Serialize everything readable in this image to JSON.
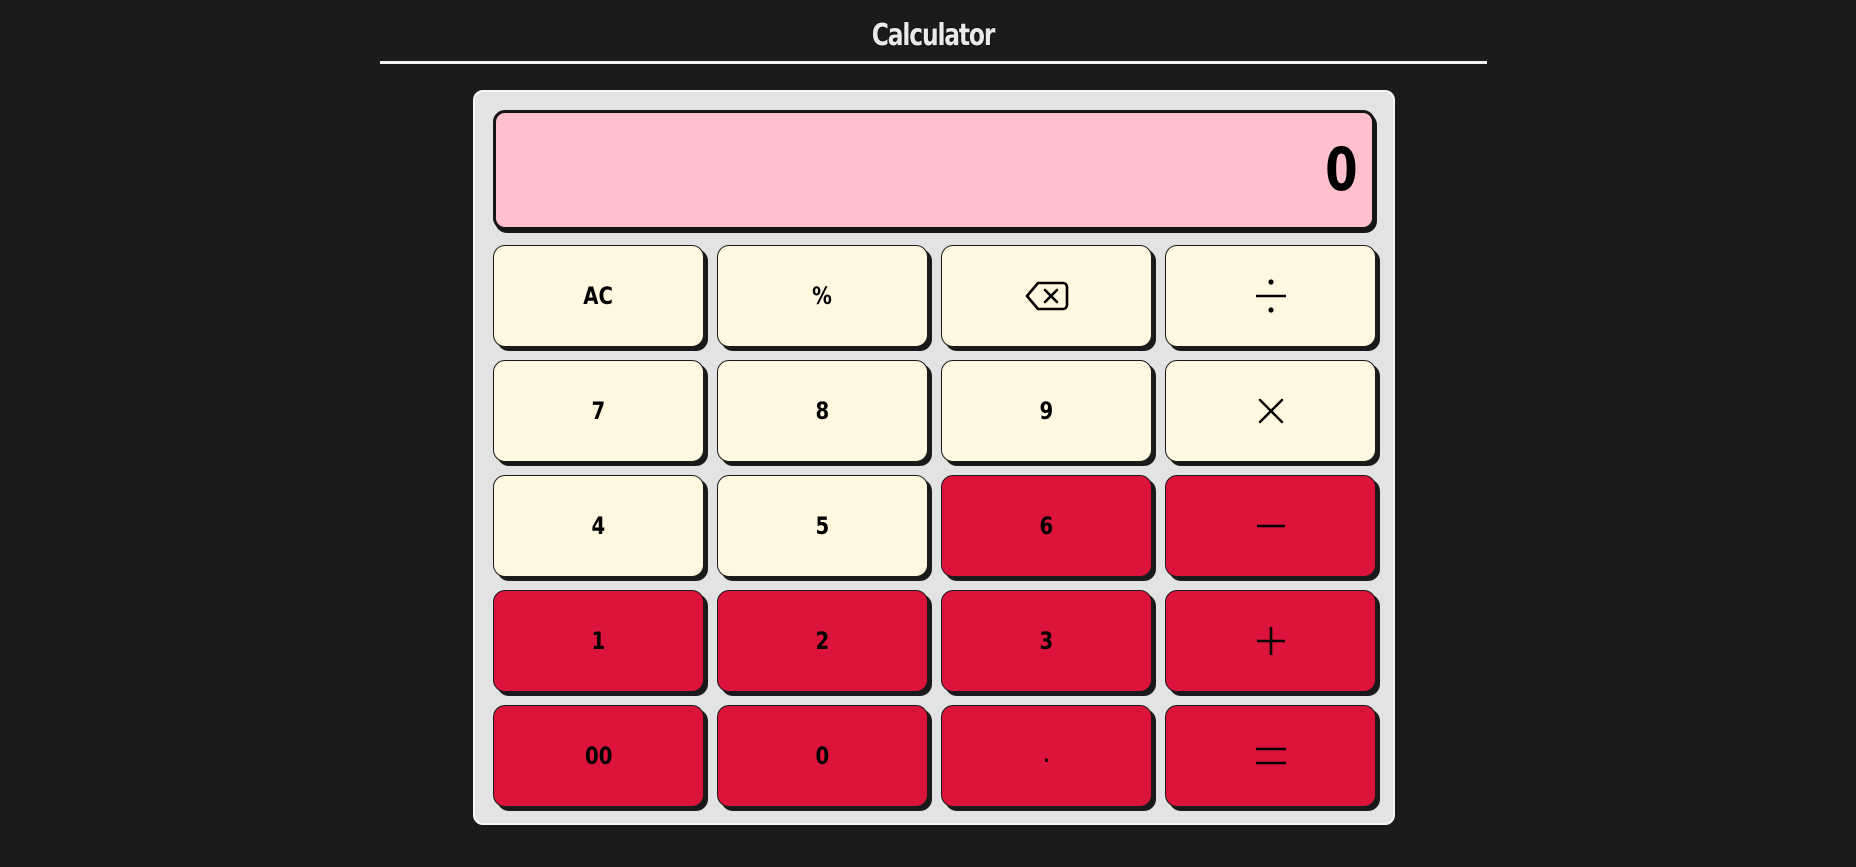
{
  "app": {
    "title": "Calculator"
  },
  "display": {
    "value": "0"
  },
  "keys": {
    "ac": "AC",
    "percent": "%",
    "seven": "7",
    "eight": "8",
    "nine": "9",
    "four": "4",
    "five": "5",
    "six": "6",
    "one": "1",
    "two": "2",
    "three": "3",
    "double_zero": "00",
    "zero": "0",
    "decimal": "."
  },
  "icons": {
    "backspace": "backspace-icon",
    "divide": "divide-icon",
    "multiply": "multiply-icon",
    "subtract": "minus-icon",
    "add": "plus-icon",
    "equals": "equals-icon"
  },
  "colors": {
    "background": "#1b1b1b",
    "panel": "#e3e3e3",
    "display": "#ffc0cb",
    "key_light": "#fff8e1",
    "key_accent": "#dc143c"
  }
}
